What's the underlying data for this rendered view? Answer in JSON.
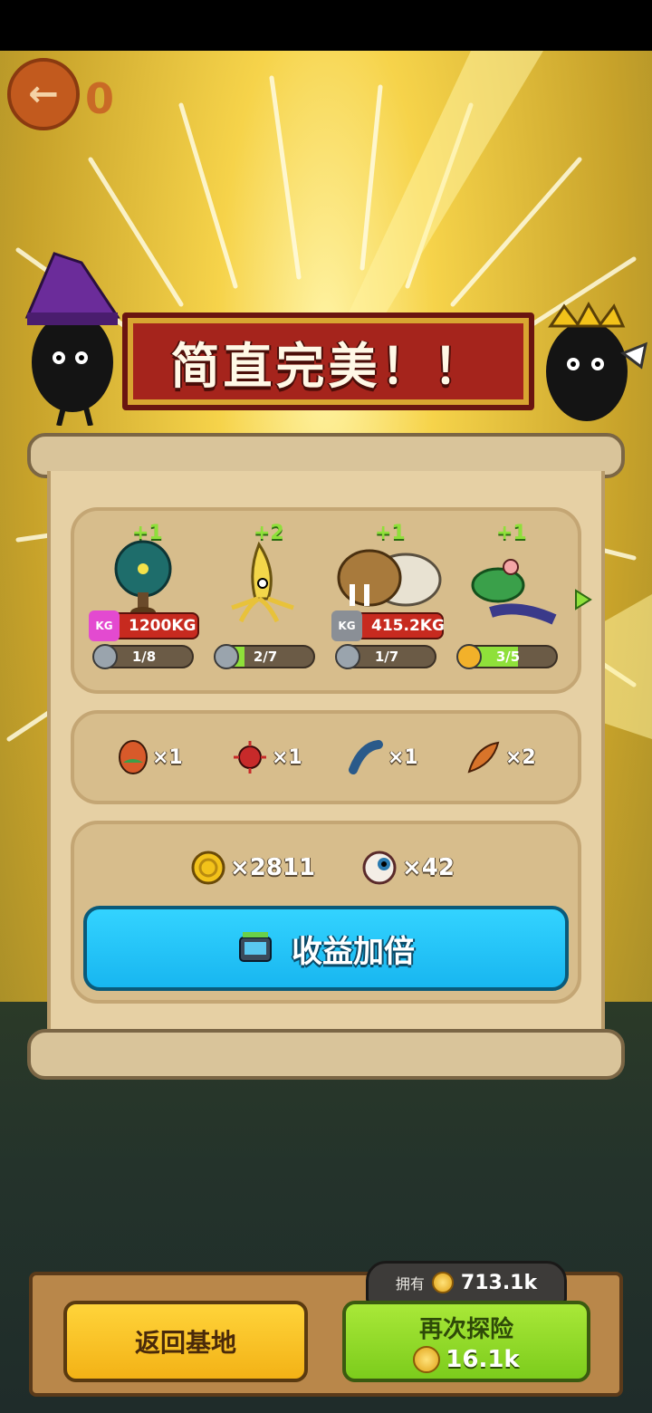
{
  "header": {
    "back_count": "0"
  },
  "banner": {
    "title": "简直完美！！"
  },
  "creatures": [
    {
      "plus": "+1",
      "weight": "1200KG",
      "progress_text": "1/8",
      "progress": 0.125,
      "weight_badge_color": "#e34ad0"
    },
    {
      "plus": "+2",
      "weight": "",
      "progress_text": "2/7",
      "progress": 0.286
    },
    {
      "plus": "+1",
      "weight": "415.2KG",
      "progress_text": "1/7",
      "progress": 0.143,
      "weight_badge_color": "#8a8f96"
    },
    {
      "plus": "+1",
      "weight": "",
      "progress_text": "3/5",
      "progress": 0.6
    }
  ],
  "materials": [
    {
      "icon": "egg-icon",
      "count": "×1"
    },
    {
      "icon": "red-spiky-fruit-icon",
      "count": "×1"
    },
    {
      "icon": "blue-larva-icon",
      "count": "×1"
    },
    {
      "icon": "feather-icon",
      "count": "×2"
    }
  ],
  "rewards": {
    "coins": "×2811",
    "eyes": "×42"
  },
  "double_button": {
    "label": "收益加倍",
    "icon": "tv-ad-icon"
  },
  "footer": {
    "owned_label": "拥有",
    "owned_value": "713.1k",
    "return_label": "返回基地",
    "again_label": "再次探险",
    "again_cost": "16.1k"
  },
  "colors": {
    "banner": "#a5241c",
    "accent_green": "#8fe03a",
    "button_blue": "#18b6f0",
    "button_yellow": "#f3b216"
  }
}
